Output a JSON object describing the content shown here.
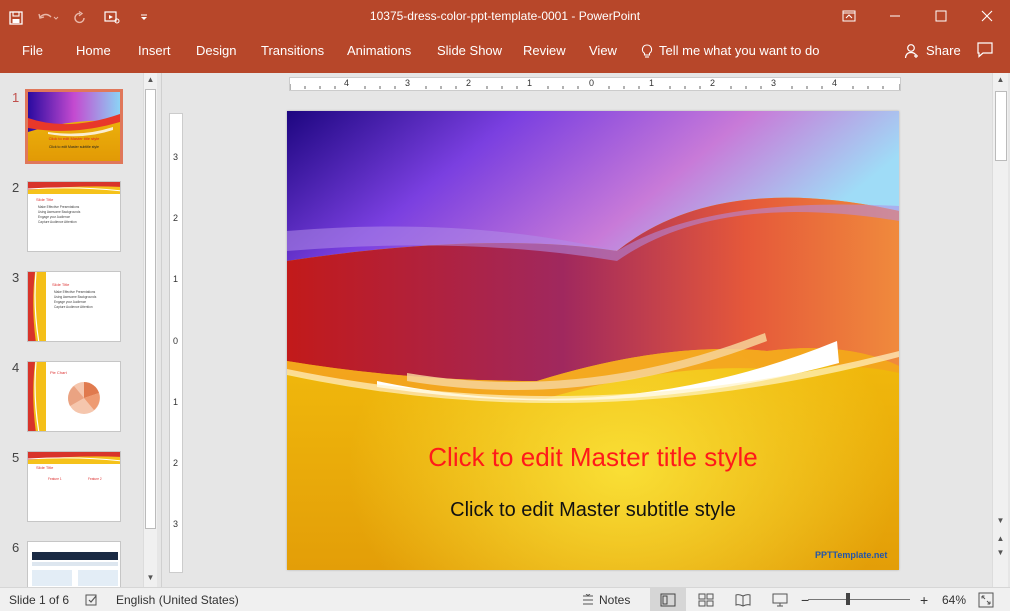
{
  "window": {
    "title": "10375-dress-color-ppt-template-0001 - PowerPoint"
  },
  "ribbon": {
    "tabs": [
      {
        "label": "File"
      },
      {
        "label": "Home"
      },
      {
        "label": "Insert"
      },
      {
        "label": "Design"
      },
      {
        "label": "Transitions"
      },
      {
        "label": "Animations"
      },
      {
        "label": "Slide Show"
      },
      {
        "label": "Review"
      },
      {
        "label": "View"
      }
    ],
    "tell_me": "Tell me what you want to do",
    "share": "Share"
  },
  "thumbnails": [
    {
      "number": "1",
      "title": "Click to edit Master title style",
      "subtitle": "Click to edit Master subtitle style"
    },
    {
      "number": "2",
      "title": "Slide Title",
      "bullets": [
        "Make Effective Presentations",
        "Using Awesome Backgrounds",
        "Engage your Audience",
        "Capture Audience Attention"
      ]
    },
    {
      "number": "3",
      "title": "Slide Title",
      "bullets": [
        "Make Effective Presentations",
        "Using Awesome Backgrounds",
        "Engage your Audience",
        "Capture Audience Attention"
      ]
    },
    {
      "number": "4",
      "title": "Pie Chart"
    },
    {
      "number": "5",
      "title": "Slide Title",
      "col_a": "Feature 1",
      "col_b": "Feature 2"
    },
    {
      "number": "6"
    }
  ],
  "ruler": {
    "h_labels": [
      "4",
      "3",
      "2",
      "1",
      "0",
      "1",
      "2",
      "3",
      "4"
    ],
    "v_labels": [
      "3",
      "2",
      "1",
      "0",
      "1",
      "2",
      "3"
    ]
  },
  "slide": {
    "title": "Click to edit Master title style",
    "subtitle": "Click to edit Master subtitle style",
    "logo": "PPTTemplate.net"
  },
  "status": {
    "slide_counter": "Slide 1 of 6",
    "language": "English (United States)",
    "notes": "Notes",
    "zoom": "64%"
  },
  "colors": {
    "accent": "#b7472a",
    "title_red": "#ff1a1a"
  }
}
